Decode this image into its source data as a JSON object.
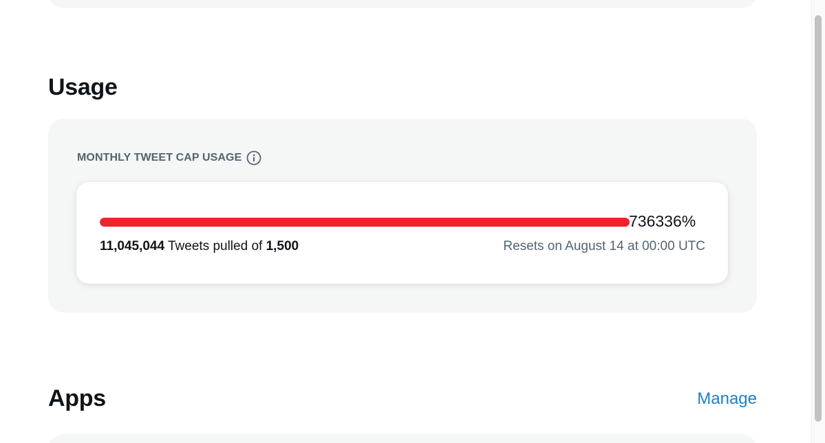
{
  "usage": {
    "title": "Usage",
    "cap_label": "MONTHLY TWEET CAP USAGE",
    "info_icon": "info-circle-icon",
    "percent_text": "736336%",
    "bar_fill_fraction": 1.0,
    "bar_color": "#f4212e",
    "pulled_count": "11,045,044",
    "pulled_text": " Tweets pulled of ",
    "cap_count": "1,500",
    "resets_text": "Resets on August 14 at 00:00 UTC"
  },
  "apps": {
    "title": "Apps",
    "manage_label": "Manage"
  },
  "colors": {
    "link": "#1d81c4",
    "card_bg": "#f5f6f6",
    "muted_text": "#536471"
  }
}
